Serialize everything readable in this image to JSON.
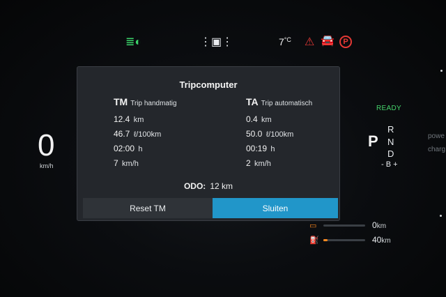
{
  "status": {
    "temperature": "7",
    "temperature_unit": "°C",
    "lights_icon": "low-beam-headlights-icon",
    "lane_icon": "lane-assist-icon",
    "seatbelt_icon": "seatbelt-warning-icon",
    "door_icon": "door-open-icon",
    "park_brake_label": "P"
  },
  "speed": {
    "value": "0",
    "unit": "km/h"
  },
  "drive": {
    "ready": "READY",
    "current_gear": "P",
    "gears": {
      "r": "R",
      "n": "N",
      "d": "D",
      "b": "- B +"
    },
    "side_text_1": "powe",
    "side_text_2": "charg"
  },
  "range": [
    {
      "icon": "battery-range-icon",
      "value": "0",
      "unit": "km",
      "fill": 0.0
    },
    {
      "icon": "fuel-range-icon",
      "value": "40",
      "unit": "km",
      "fill": 0.1
    }
  ],
  "tripcomputer": {
    "title": "Tripcomputer",
    "tm": {
      "label": "TM",
      "sublabel": "Trip handmatig",
      "distance": "12.4",
      "distance_unit": "km",
      "consumption": "46.7",
      "consumption_unit": "ℓ/100km",
      "time": "02:00",
      "time_unit": "h",
      "avg_speed": "7",
      "avg_speed_unit": "km/h"
    },
    "ta": {
      "label": "TA",
      "sublabel": "Trip automatisch",
      "distance": "0.4",
      "distance_unit": "km",
      "consumption": "50.0",
      "consumption_unit": "ℓ/100km",
      "time": "00:19",
      "time_unit": "h",
      "avg_speed": "2",
      "avg_speed_unit": "km/h"
    },
    "odo_label": "ODO:",
    "odo_value": "12",
    "odo_unit": "km",
    "reset_button": "Reset TM",
    "close_button": "Sluiten"
  },
  "colors": {
    "accent_button": "#2196c9",
    "ready_green": "#45d36b",
    "warning_red": "#e53935",
    "range_orange": "#ff8a1f"
  }
}
